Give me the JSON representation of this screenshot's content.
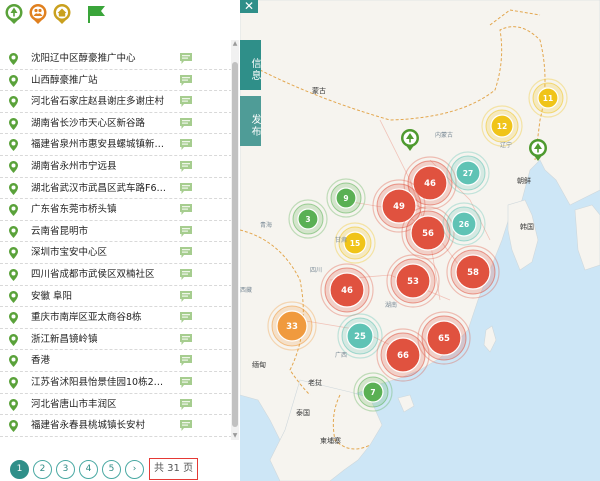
{
  "filters": [
    {
      "icon": "tree-icon",
      "color": "#5aa23a"
    },
    {
      "icon": "people-icon",
      "color": "#e0801f"
    },
    {
      "icon": "house-icon",
      "color": "#c9a01e"
    },
    {
      "icon": "flag-icon",
      "color": "#3aa53a"
    }
  ],
  "list": [
    "沈阳辽中区醇豪推广中心",
    "山西醇豪推广站",
    "河北省石家庄赵县谢庄多谢庄村",
    "湖南省长沙市天心区新谷路",
    "福建省泉州市惠安县螺城镇新亭尾小...",
    "湖南省永州市宁远县",
    "湖北省武汉市武昌区武车路F6湿时区...",
    "广东省东莞市桥头镇",
    "云南省昆明市",
    "深圳市宝安中心区",
    "四川省成都市武侯区双楠社区",
    "安徽 阜阳",
    "重庆市南岸区亚太商谷8栋",
    "浙江新昌镜岭镇",
    "香港",
    "江苏省沭阳县怡景佳园10栋2单元5...",
    "河北省唐山市丰润区",
    "福建省永春县桃城镇长安村"
  ],
  "pagination": {
    "pages": [
      "1",
      "2",
      "3",
      "4",
      "5"
    ],
    "next": "›",
    "total": "共 31 页"
  },
  "map": {
    "close": "✕",
    "tab_info": "信息",
    "tab_publish": "发布",
    "labels": [
      {
        "text": "蒙古",
        "size": "normal"
      },
      {
        "text": "朝鲜",
        "size": "normal"
      },
      {
        "text": "韩国",
        "size": "normal"
      },
      {
        "text": "缅甸",
        "size": "normal"
      },
      {
        "text": "老挝",
        "size": "normal"
      },
      {
        "text": "泰国",
        "size": "normal"
      },
      {
        "text": "柬埔寨",
        "size": "normal"
      },
      {
        "text": "内蒙古",
        "size": "small"
      },
      {
        "text": "辽宁",
        "size": "small"
      },
      {
        "text": "青海",
        "size": "small"
      },
      {
        "text": "甘肃",
        "size": "small"
      },
      {
        "text": "四川",
        "size": "small"
      },
      {
        "text": "西藏",
        "size": "small"
      },
      {
        "text": "湖南",
        "size": "small"
      },
      {
        "text": "广西",
        "size": "small"
      }
    ],
    "clusters": [
      {
        "count": "11",
        "color": "#f0c419"
      },
      {
        "count": "12",
        "color": "#f0c419"
      },
      {
        "count": "46",
        "color": "#e0523f"
      },
      {
        "count": "27",
        "color": "#5fc3b5"
      },
      {
        "count": "49",
        "color": "#e0523f"
      },
      {
        "count": "9",
        "color": "#5ab054"
      },
      {
        "count": "3",
        "color": "#5ab054"
      },
      {
        "count": "56",
        "color": "#e0523f"
      },
      {
        "count": "26",
        "color": "#5fc3b5"
      },
      {
        "count": "15",
        "color": "#f0c419"
      },
      {
        "count": "58",
        "color": "#e0523f"
      },
      {
        "count": "53",
        "color": "#e0523f"
      },
      {
        "count": "46",
        "color": "#e0523f"
      },
      {
        "count": "33",
        "color": "#f09a3e"
      },
      {
        "count": "25",
        "color": "#5fc3b5"
      },
      {
        "count": "65",
        "color": "#e0523f"
      },
      {
        "count": "66",
        "color": "#e0523f"
      },
      {
        "count": "7",
        "color": "#5ab054"
      }
    ],
    "tree_markers": [
      {
        "name": "tree-marker-inner-mongolia",
        "color": "#4e9a2f"
      },
      {
        "name": "tree-marker-northeast",
        "color": "#4e9a2f"
      }
    ]
  }
}
